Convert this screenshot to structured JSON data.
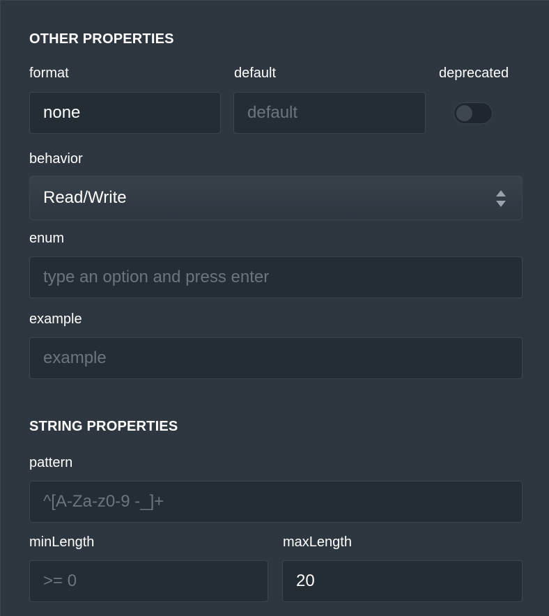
{
  "other": {
    "title": "OTHER PROPERTIES",
    "format": {
      "label": "format",
      "value": "none"
    },
    "default": {
      "label": "default",
      "placeholder": "default",
      "value": ""
    },
    "deprecated": {
      "label": "deprecated",
      "on": false
    },
    "behavior": {
      "label": "behavior",
      "value": "Read/Write"
    },
    "enum": {
      "label": "enum",
      "placeholder": "type an option and press enter",
      "value": ""
    },
    "example": {
      "label": "example",
      "placeholder": "example",
      "value": ""
    }
  },
  "string": {
    "title": "STRING PROPERTIES",
    "pattern": {
      "label": "pattern",
      "placeholder": "^[A-Za-z0-9 -_]+",
      "value": ""
    },
    "minLength": {
      "label": "minLength",
      "placeholder": ">= 0",
      "value": ""
    },
    "maxLength": {
      "label": "maxLength",
      "value": "20"
    }
  },
  "colors": {
    "panel_bg": "#2e3740",
    "field_bg": "#242c34",
    "placeholder": "#6c757d"
  }
}
